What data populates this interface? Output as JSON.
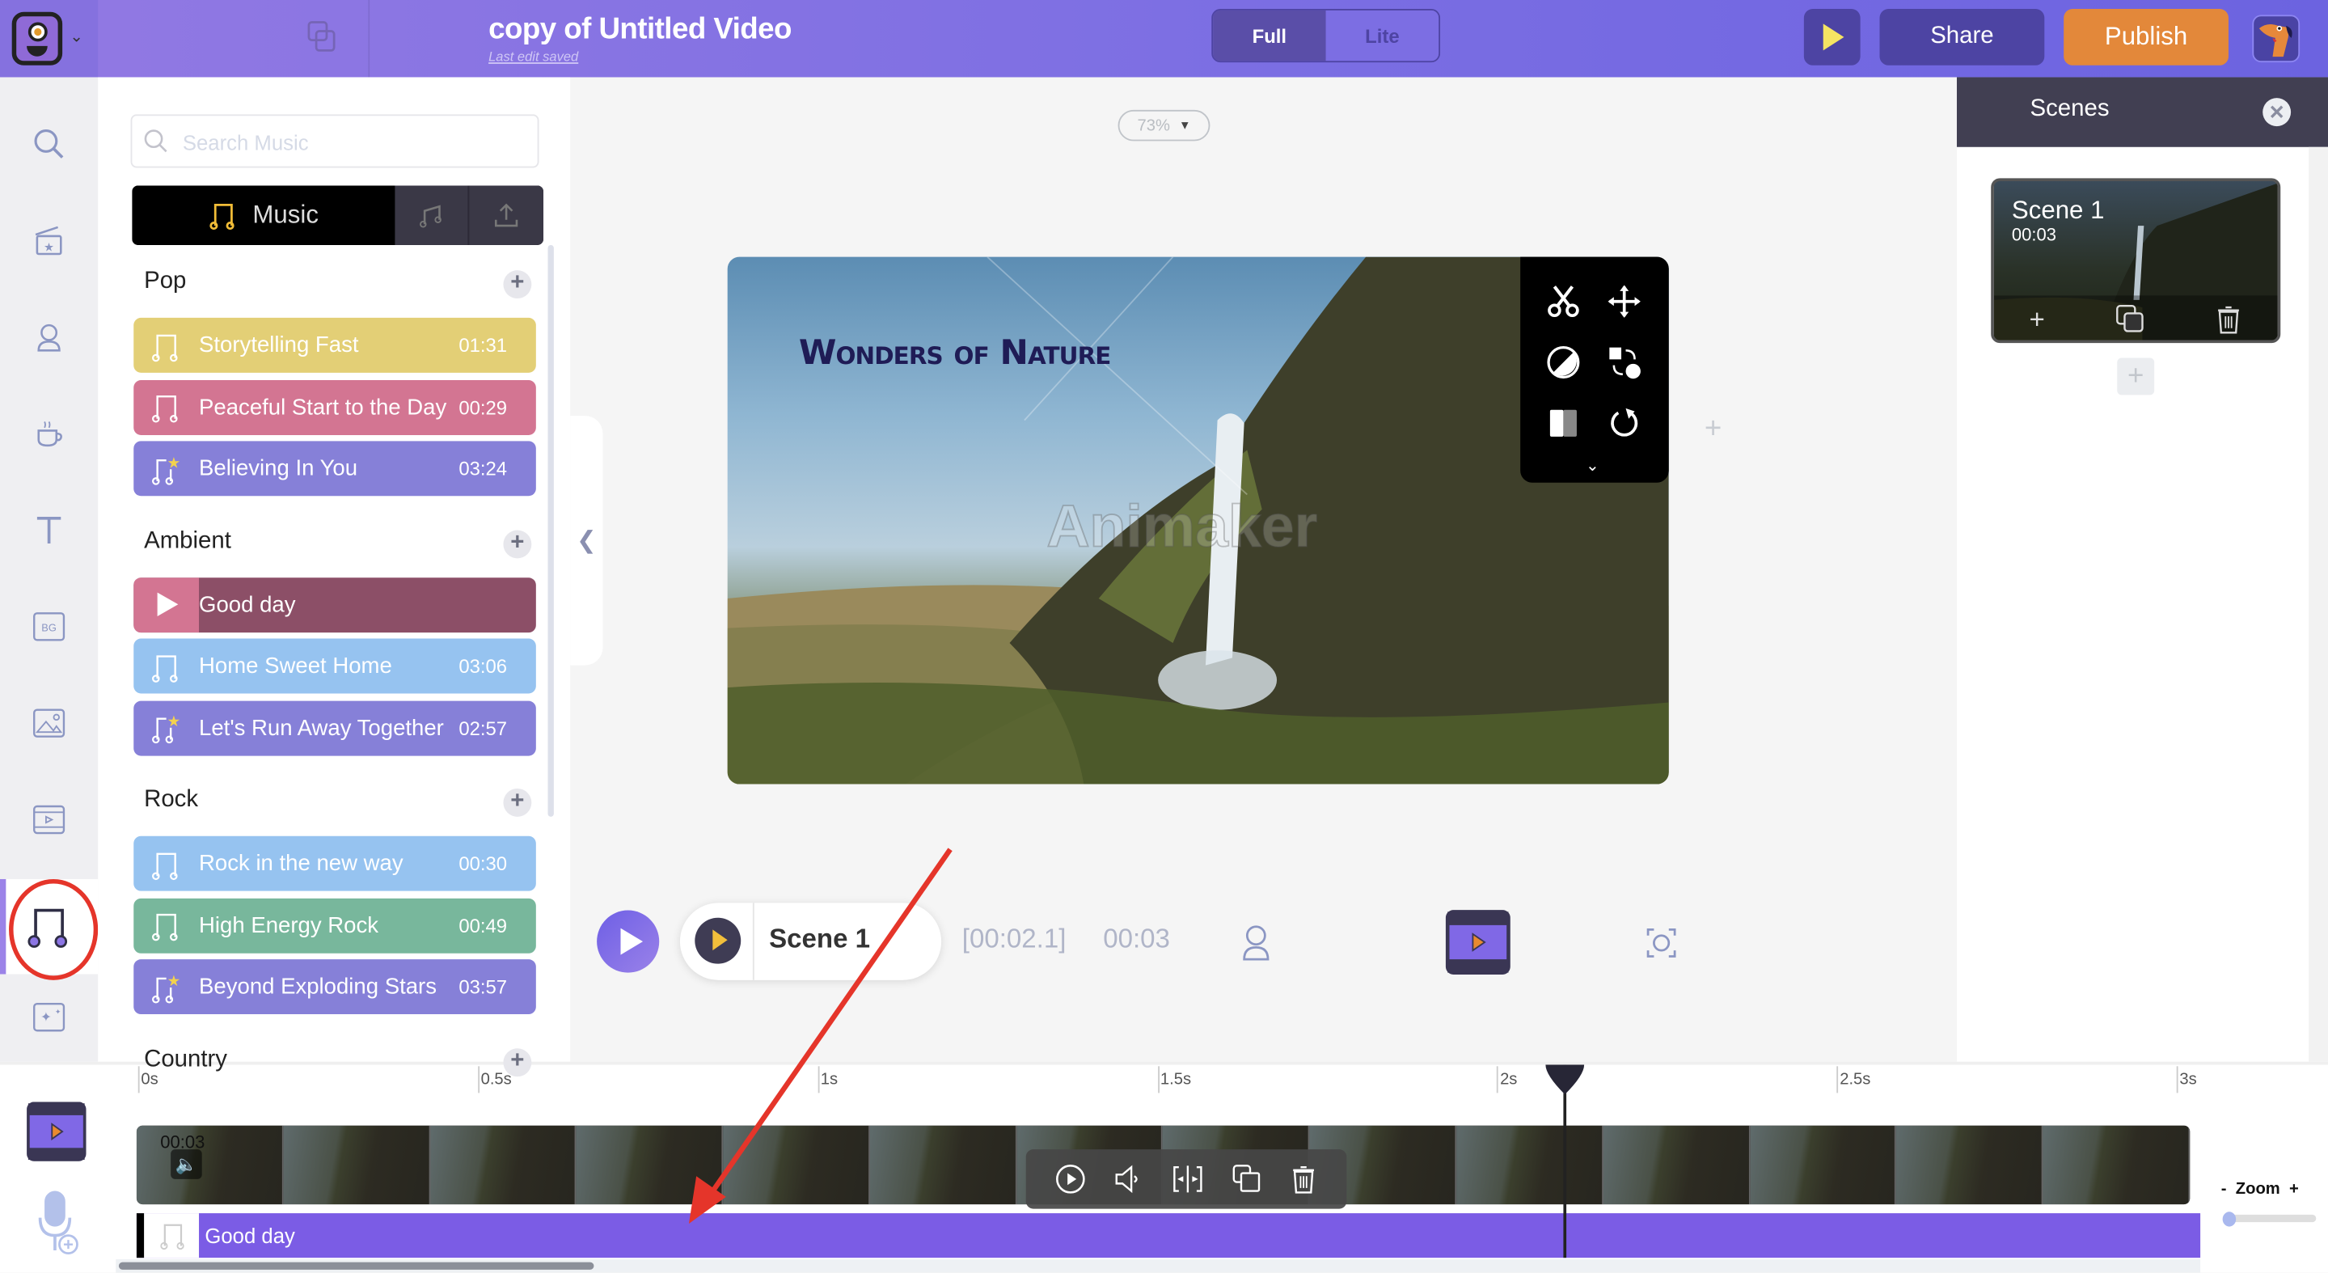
{
  "header": {
    "title": "copy of Untitled Video",
    "save_status": "Last edit saved",
    "mode_options": [
      "Full",
      "Lite"
    ],
    "mode_selected": "Full",
    "share_label": "Share",
    "publish_label": "Publish"
  },
  "sidebar": {
    "items": [
      {
        "icon": "search-icon"
      },
      {
        "icon": "clapperboard-star-icon"
      },
      {
        "icon": "character-icon"
      },
      {
        "icon": "coffee-cup-icon"
      },
      {
        "icon": "text-icon"
      },
      {
        "icon": "bg-icon",
        "label": "BG"
      },
      {
        "icon": "image-icon"
      },
      {
        "icon": "video-icon"
      },
      {
        "icon": "music-icon",
        "active": true
      },
      {
        "icon": "effects-sparkle-icon"
      }
    ]
  },
  "music_panel": {
    "search_placeholder": "Search Music",
    "tabs": {
      "music": "Music"
    },
    "categories": [
      {
        "title": "Pop",
        "tracks": [
          {
            "name": "Storytelling Fast",
            "duration": "01:31",
            "color": "#e3cf76",
            "premium": false
          },
          {
            "name": "Peaceful Start to the Day",
            "duration": "00:29",
            "color": "#d37592",
            "premium": false
          },
          {
            "name": "Believing In You",
            "duration": "03:24",
            "color": "#8680d8",
            "premium": true
          }
        ]
      },
      {
        "title": "Ambient",
        "tracks": [
          {
            "name": "Good day",
            "duration": "",
            "color": "#8c4f67",
            "playing": true
          },
          {
            "name": "Home Sweet Home",
            "duration": "03:06",
            "color": "#96c3f0",
            "premium": false
          },
          {
            "name": "Let's Run Away Together",
            "duration": "02:57",
            "color": "#8680d8",
            "premium": true
          }
        ]
      },
      {
        "title": "Rock",
        "tracks": [
          {
            "name": "Rock in the new way",
            "duration": "00:30",
            "color": "#96c3f0",
            "premium": false
          },
          {
            "name": "High Energy Rock",
            "duration": "00:49",
            "color": "#78b79c",
            "premium": false
          },
          {
            "name": "Beyond Exploding Stars",
            "duration": "03:57",
            "color": "#8680d8",
            "premium": true
          }
        ]
      },
      {
        "title": "Country",
        "tracks": []
      }
    ]
  },
  "canvas": {
    "zoom_level": "73%",
    "video_title": "Wonders of Nature",
    "watermark": "Animaker"
  },
  "playback": {
    "scene_label": "Scene 1",
    "current_time": "[00:02.1]",
    "total_time": "00:03"
  },
  "scenes_panel": {
    "title": "Scenes",
    "scenes": [
      {
        "name": "Scene 1",
        "duration": "00:03"
      }
    ]
  },
  "timeline": {
    "ticks": [
      "0s",
      "0.5s",
      "1s",
      "1.5s",
      "2s",
      "2.5s",
      "3s"
    ],
    "playhead_seconds": 2.1,
    "video_clip_duration": "00:03",
    "audio_clip_name": "Good day",
    "zoom_label": "Zoom",
    "zoom_minus": "-",
    "zoom_plus": "+",
    "zoom_value": 0
  },
  "colors": {
    "accent": "#7b6ee3",
    "publish": "#e3883a",
    "audio_track": "#7b5ce5",
    "annotation": "#e5352a"
  }
}
